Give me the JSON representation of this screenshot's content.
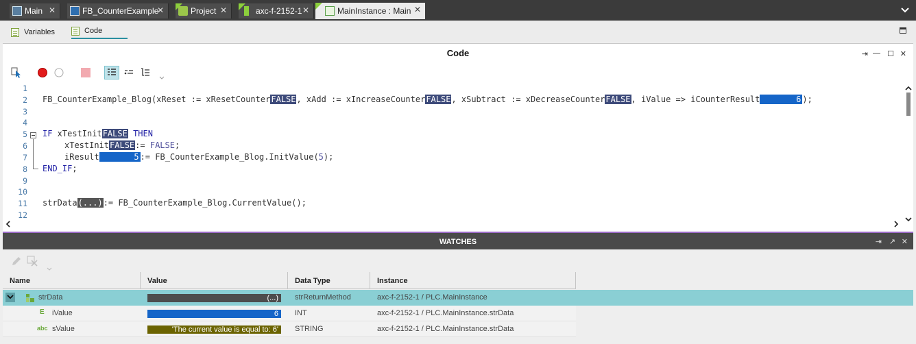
{
  "doc_tabs": [
    {
      "label": "Main",
      "close": "✕"
    },
    {
      "label": "FB_CounterExample",
      "close": "✕"
    },
    {
      "label": "Project",
      "close": "✕"
    },
    {
      "label": "axc-f-2152-1",
      "close": "✕"
    },
    {
      "label": "MainInstance : Main",
      "close": "✕"
    }
  ],
  "sub_tabs": {
    "variables": "Variables",
    "code": "Code"
  },
  "code_panel": {
    "title": "Code",
    "line_numbers": [
      "1",
      "2",
      "3",
      "4",
      "5",
      "6",
      "7",
      "8",
      "9",
      "10",
      "11",
      "12"
    ],
    "line2": {
      "prefix": "FB_CounterExample_Blog(xReset := xResetCounter",
      "v1": "FALSE",
      "mid1": ", xAdd := xIncreaseCounter",
      "v2": "FALSE",
      "mid2": ", xSubtract := xDecreaseCounter",
      "v3": "FALSE",
      "mid3": ", iValue => iCounterResult",
      "v4": "6",
      "suffix": ");"
    },
    "line5": {
      "kw_if": "IF",
      "var": " xTestInit",
      "val": "FALSE",
      "kw_then": "THEN"
    },
    "line6": {
      "var": "xTestInit",
      "val": "FALSE",
      "rest_op": ":= ",
      "rest_lit": "FALSE",
      "end": ";"
    },
    "line7": {
      "var": "iResult",
      "val": "5",
      "rest": ":= FB_CounterExample_Blog.InitValue(",
      "arg": "5",
      "end": ");"
    },
    "line8": {
      "kw": "END_IF",
      "end": ";"
    },
    "line11": {
      "var": "strData",
      "val": "(...)",
      "rest": ":= FB_CounterExample_Blog.CurrentValue",
      "end": "();"
    }
  },
  "watches": {
    "title": "WATCHES",
    "columns": [
      "Name",
      "Value",
      "Data Type",
      "Instance"
    ],
    "rows": [
      {
        "name": "strData",
        "value": "(...)",
        "type": "strReturnMethod",
        "instance": "axc-f-2152-1 / PLC.MainInstance"
      },
      {
        "name": "iValue",
        "value": "6",
        "type": "INT",
        "instance": "axc-f-2152-1 / PLC.MainInstance.strData"
      },
      {
        "name": "sValue",
        "value": "'The current value is equal to: 6'",
        "type": "STRING",
        "instance": "axc-f-2152-1 / PLC.MainInstance.strData"
      }
    ],
    "icon_labels": {
      "int": "E",
      "string": "abc"
    }
  },
  "colors": {
    "selected_row": "#8acfd4",
    "accent": "#2a8fa0",
    "value_blue": "#1565c8",
    "value_false": "#3d4a7a"
  }
}
